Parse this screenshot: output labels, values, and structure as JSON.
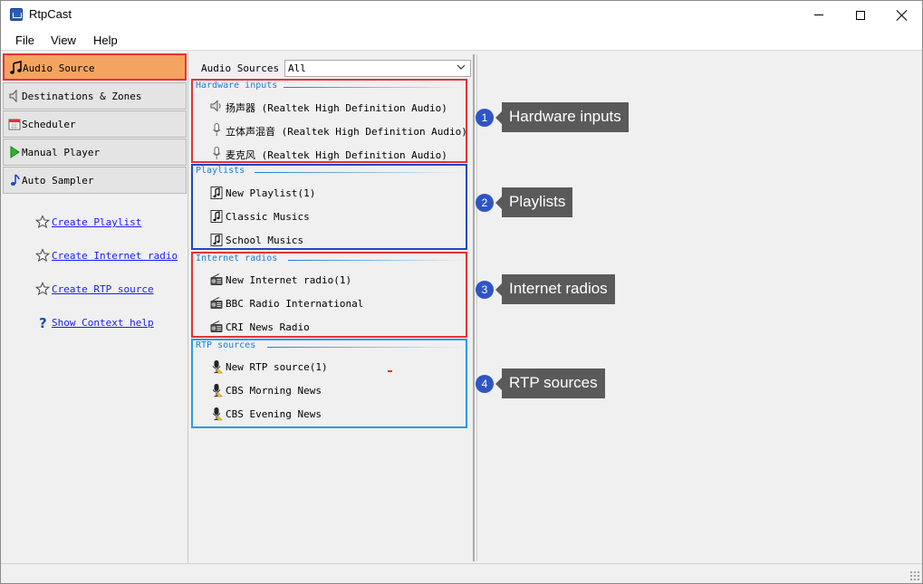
{
  "window": {
    "title": "RtpCast"
  },
  "menu": [
    "File",
    "View",
    "Help"
  ],
  "nav": [
    {
      "label": "Audio Source",
      "icon": "music-note-icon",
      "active": true
    },
    {
      "label": "Destinations & Zones",
      "icon": "speaker-icon",
      "active": false
    },
    {
      "label": "Scheduler",
      "icon": "calendar-icon",
      "active": false
    },
    {
      "label": "Manual Player",
      "icon": "play-icon",
      "active": false
    },
    {
      "label": "Auto Sampler",
      "icon": "music-note-icon",
      "active": false
    }
  ],
  "tasks": [
    {
      "label": "Create Playlist",
      "icon": "star-icon"
    },
    {
      "label": "Create Internet radio",
      "icon": "star-icon"
    },
    {
      "label": "Create RTP source",
      "icon": "star-icon"
    },
    {
      "label": "Show Context help",
      "icon": "help-icon"
    }
  ],
  "source_filter": {
    "label": "Audio Sources",
    "value": "All"
  },
  "groups": [
    {
      "title": "Hardware inputs",
      "items": [
        {
          "label": "扬声器 (Realtek High Definition Audio)",
          "icon": "speaker-icon"
        },
        {
          "label": "立体声混音 (Realtek High Definition Audio)",
          "icon": "microphone-icon"
        },
        {
          "label": "麦克风 (Realtek High Definition Audio)",
          "icon": "microphone-icon"
        }
      ]
    },
    {
      "title": "Playlists",
      "items": [
        {
          "label": "New Playlist(1)",
          "icon": "playlist-icon"
        },
        {
          "label": "Classic Musics",
          "icon": "playlist-icon"
        },
        {
          "label": "School Musics",
          "icon": "playlist-icon"
        }
      ]
    },
    {
      "title": "Internet radios",
      "items": [
        {
          "label": "New Internet radio(1)",
          "icon": "radio-icon"
        },
        {
          "label": "BBC Radio International",
          "icon": "radio-icon"
        },
        {
          "label": "CRI News Radio",
          "icon": "radio-icon"
        }
      ]
    },
    {
      "title": "RTP sources",
      "items": [
        {
          "label": "New RTP source(1)",
          "icon": "rtp-mic-icon"
        },
        {
          "label": "CBS Morning News",
          "icon": "rtp-mic-icon"
        },
        {
          "label": "CBS Evening News",
          "icon": "rtp-mic-icon"
        }
      ]
    }
  ],
  "callouts": [
    {
      "num": "1",
      "label": "Hardware inputs"
    },
    {
      "num": "2",
      "label": "Playlists"
    },
    {
      "num": "3",
      "label": "Internet radios"
    },
    {
      "num": "4",
      "label": "RTP sources"
    }
  ],
  "colors": {
    "active_nav": "#f4a460",
    "highlight_red": "#e83232",
    "highlight_blue": "#1f47c2",
    "highlight_light_blue": "#2e9ae6",
    "link": "#1a1aff",
    "callout_bg": "#5a5a5a",
    "callout_num": "#2f55c4"
  }
}
